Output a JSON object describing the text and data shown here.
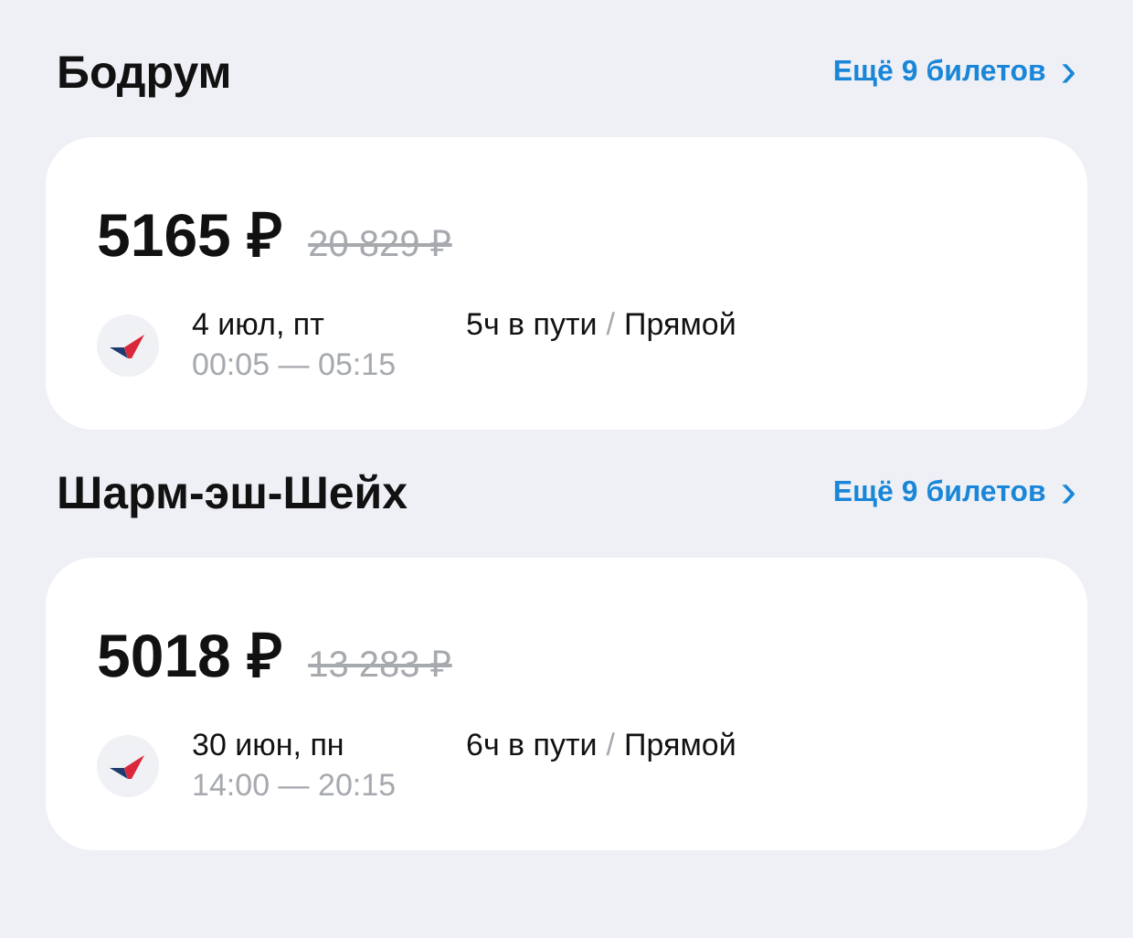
{
  "destinations": [
    {
      "city": "Бодрум",
      "more_link": "Ещё 9 билетов",
      "chevron": "›",
      "price": "5165 ₽",
      "old_price": "20 829 ₽",
      "date": "4 июл, пт",
      "times": "00:05 — 05:15",
      "duration": "5ч в пути",
      "separator": "/",
      "route_type": "Прямой"
    },
    {
      "city": "Шарм-эш-Шейх",
      "more_link": "Ещё 9 билетов",
      "chevron": "›",
      "price": "5018 ₽",
      "old_price": "13 283 ₽",
      "date": "30 июн, пн",
      "times": "14:00 — 20:15",
      "duration": "6ч в пути",
      "separator": "/",
      "route_type": "Прямой"
    }
  ]
}
